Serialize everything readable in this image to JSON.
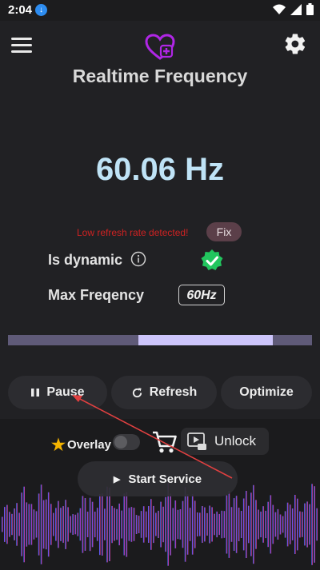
{
  "status_bar": {
    "time": "2:04",
    "app_icon": "download-badge-icon",
    "icons": [
      "wifi-icon",
      "signal-icon",
      "battery-icon"
    ]
  },
  "header": {
    "title": "Realtime Frequency",
    "menu_icon": "hamburger-menu-icon",
    "settings_icon": "gear-icon",
    "logo_icon": "heart-plus-logo-icon"
  },
  "frequency": {
    "value": "60.06 Hz"
  },
  "warning": {
    "text": "Low refresh rate detected!",
    "fix_label": "Fix",
    "color": "#cf2222"
  },
  "dynamic": {
    "label": "Is dynamic",
    "info_icon": "info-icon",
    "status_icon": "verified-check-icon"
  },
  "max_frequency": {
    "label": "Max Freqency",
    "value": "60Hz"
  },
  "progress": {
    "start_fraction": 0.43,
    "end_fraction": 0.87
  },
  "controls": {
    "pause": "Pause",
    "refresh": "Refresh",
    "optimize": "Optimize"
  },
  "bottom": {
    "overlay_label": "Overlay",
    "overlay_enabled": false,
    "unlock_label": "Unlock",
    "start_label": "Start Service"
  },
  "colors": {
    "accent": "#cdc5fb",
    "frequency": "#bfe3f6",
    "logo": "#b026e6"
  }
}
